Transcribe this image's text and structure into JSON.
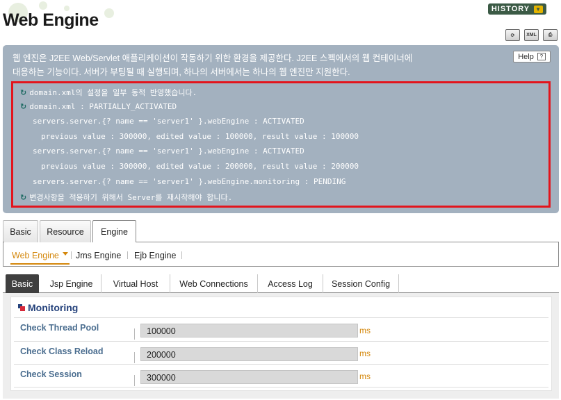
{
  "header": {
    "title": "Web Engine",
    "history_label": "HISTORY",
    "icons": [
      "refresh-icon",
      "xml-icon",
      "print-icon"
    ]
  },
  "info": {
    "description_line1": "웹 엔진은 J2EE Web/Servlet 애플리케이션이 작동하기 위한 환경을 제공한다. J2EE 스펙에서의 웹 컨테이너에",
    "description_line2": "대응하는 기능이다. 서버가 부팅될 때 실행되며, 하나의 서버에서는 하나의 웹 엔진만 지원한다.",
    "help_label": "Help",
    "help_icon": "?"
  },
  "messages": [
    {
      "text": "domain.xml의 설정을 일부 동적 반영했습니다.",
      "icon": true
    },
    {
      "text": "domain.xml : PARTIALLY_ACTIVATED",
      "icon": true
    },
    {
      "text": "servers.server.{? name == 'server1' }.webEngine : ACTIVATED",
      "icon": false
    },
    {
      "text": "previous value : 300000, edited value : 100000, result value : 100000",
      "icon": false
    },
    {
      "text": "servers.server.{? name == 'server1' }.webEngine : ACTIVATED",
      "icon": false
    },
    {
      "text": "previous value : 300000, edited value : 200000, result value : 200000",
      "icon": false
    },
    {
      "text": "servers.server.{? name == 'server1' }.webEngine.monitoring : PENDING",
      "icon": false
    },
    {
      "text": "변경사항을 적용하기 위해서 Server를 재시작해야 합니다.",
      "icon": true
    }
  ],
  "main_tabs": [
    {
      "label": "Basic"
    },
    {
      "label": "Resource"
    },
    {
      "label": "Engine",
      "active": true
    }
  ],
  "engine_nav": [
    {
      "label": "Web Engine",
      "active": true
    },
    {
      "label": "Jms Engine"
    },
    {
      "label": "Ejb Engine"
    }
  ],
  "sub_tabs": [
    {
      "label": "Basic",
      "active": true
    },
    {
      "label": "Jsp Engine"
    },
    {
      "label": "Virtual Host"
    },
    {
      "label": "Web Connections"
    },
    {
      "label": "Access Log"
    },
    {
      "label": "Session Config"
    }
  ],
  "monitoring": {
    "title": "Monitoring",
    "rows": [
      {
        "label": "Check Thread Pool",
        "value": "100000",
        "unit": "ms"
      },
      {
        "label": "Check Class Reload",
        "value": "200000",
        "unit": "ms"
      },
      {
        "label": "Check Session",
        "value": "300000",
        "unit": "ms"
      }
    ]
  },
  "colors": {
    "info_bg": "#a3b1bf",
    "highlight_border": "#e3141c",
    "accent": "#d4870b",
    "label_blue": "#4a6d8f",
    "title_blue": "#24417b"
  }
}
